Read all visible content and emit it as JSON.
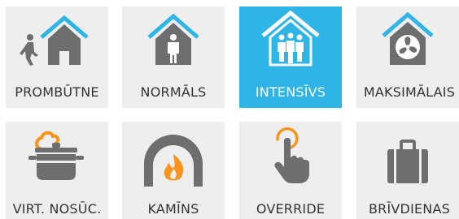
{
  "modes": [
    {
      "id": "prombutne",
      "label": "PROMBŪTNE",
      "icon": "person-walking-away-house-icon",
      "active": false
    },
    {
      "id": "normals",
      "label": "NORMĀLS",
      "icon": "person-in-house-icon",
      "active": false
    },
    {
      "id": "intensivs",
      "label": "INTENSĪVS",
      "icon": "group-in-house-icon",
      "active": true
    },
    {
      "id": "maksimalais",
      "label": "MAKSIMĀLAIS",
      "icon": "fan-house-icon",
      "active": false
    },
    {
      "id": "virt-nosuc",
      "label": "VIRT. NOSŪC.",
      "icon": "cooking-pot-icon",
      "active": false
    },
    {
      "id": "kamins",
      "label": "KAMĪNS",
      "icon": "fireplace-icon",
      "active": false
    },
    {
      "id": "override",
      "label": "OVERRIDE",
      "icon": "touch-finger-icon",
      "active": false
    },
    {
      "id": "brivdienas",
      "label": "BRĪVDIENAS",
      "icon": "suitcase-icon",
      "active": false
    }
  ],
  "colors": {
    "accent": "#2eb5e6",
    "tile_background": "#eeeeee",
    "icon_gray": "#6d6e70",
    "flame_orange": "#f7941d",
    "label_text": "#333333"
  }
}
